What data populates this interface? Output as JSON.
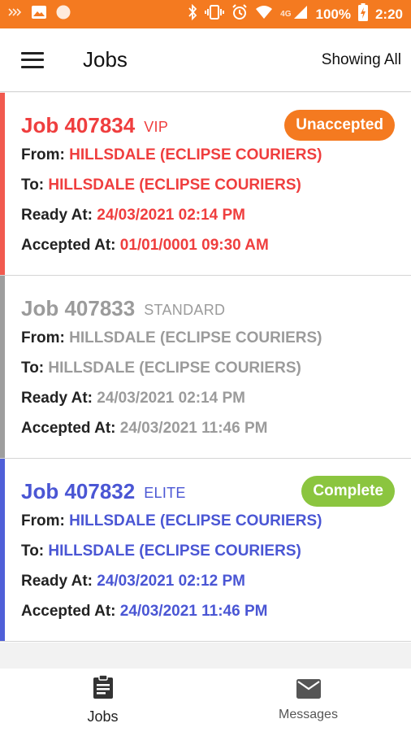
{
  "status_bar": {
    "battery": "100%",
    "time": "2:20",
    "network": "4G",
    "icons": [
      "notification-icon",
      "image-icon",
      "circle-icon",
      "bluetooth-icon",
      "vibrate-icon",
      "alarm-icon",
      "wifi-icon",
      "signal-icon",
      "battery-charging-icon"
    ]
  },
  "app_bar": {
    "title": "Jobs",
    "filter_label": "Showing All",
    "menu_icon": "hamburger-menu-icon"
  },
  "labels": {
    "from": "From: ",
    "to": "To: ",
    "ready_at": "Ready At: ",
    "accepted_at": "Accepted At: "
  },
  "jobs": [
    {
      "number": "Job 407834",
      "level": "VIP",
      "status": "Unaccepted",
      "from": "HILLSDALE (ECLIPSE COURIERS)",
      "to": "HILLSDALE (ECLIPSE COURIERS)",
      "ready_at": "24/03/2021 02:14 PM",
      "accepted_at": "01/01/0001 09:30 AM",
      "accent_color": "#ef3e3e",
      "badge_color": "#f47a20"
    },
    {
      "number": "Job 407833",
      "level": "STANDARD",
      "status": "",
      "from": "HILLSDALE (ECLIPSE COURIERS)",
      "to": "HILLSDALE (ECLIPSE COURIERS)",
      "ready_at": "24/03/2021 02:14 PM",
      "accepted_at": "24/03/2021 11:46 PM",
      "accent_color": "#9b9b9b"
    },
    {
      "number": "Job 407832",
      "level": "ELITE",
      "status": "Complete",
      "from": "HILLSDALE (ECLIPSE COURIERS)",
      "to": "HILLSDALE (ECLIPSE COURIERS)",
      "ready_at": "24/03/2021 02:12 PM",
      "accepted_at": "24/03/2021 11:46 PM",
      "accent_color": "#4a56d4",
      "badge_color": "#8bc53f"
    }
  ],
  "bottom_nav": [
    {
      "label": "Jobs",
      "icon": "clipboard-icon"
    },
    {
      "label": "Messages",
      "icon": "mail-icon"
    }
  ],
  "colors": {
    "status_bar": "#f47a20",
    "vip": "#ef3e3e",
    "standard": "#9b9b9b",
    "elite": "#4a56d4",
    "unaccepted_badge": "#f47a20",
    "complete_badge": "#8bc53f"
  }
}
